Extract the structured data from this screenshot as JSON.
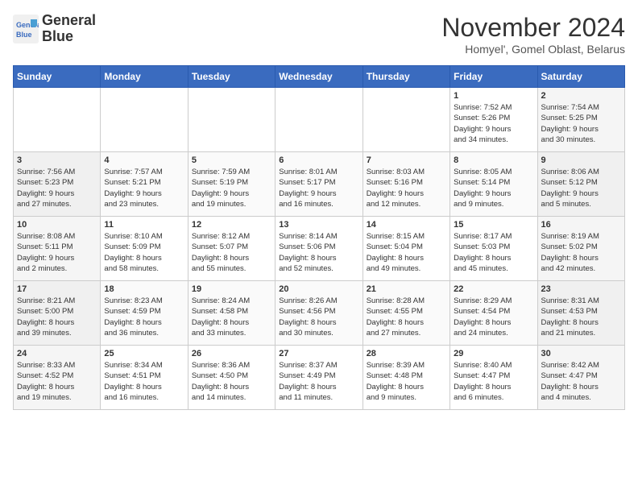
{
  "header": {
    "logo_line1": "General",
    "logo_line2": "Blue",
    "month_title": "November 2024",
    "subtitle": "Homyel', Gomel Oblast, Belarus"
  },
  "days_of_week": [
    "Sunday",
    "Monday",
    "Tuesday",
    "Wednesday",
    "Thursday",
    "Friday",
    "Saturday"
  ],
  "weeks": [
    [
      {
        "day": "",
        "info": ""
      },
      {
        "day": "",
        "info": ""
      },
      {
        "day": "",
        "info": ""
      },
      {
        "day": "",
        "info": ""
      },
      {
        "day": "",
        "info": ""
      },
      {
        "day": "1",
        "info": "Sunrise: 7:52 AM\nSunset: 5:26 PM\nDaylight: 9 hours\nand 34 minutes."
      },
      {
        "day": "2",
        "info": "Sunrise: 7:54 AM\nSunset: 5:25 PM\nDaylight: 9 hours\nand 30 minutes."
      }
    ],
    [
      {
        "day": "3",
        "info": "Sunrise: 7:56 AM\nSunset: 5:23 PM\nDaylight: 9 hours\nand 27 minutes."
      },
      {
        "day": "4",
        "info": "Sunrise: 7:57 AM\nSunset: 5:21 PM\nDaylight: 9 hours\nand 23 minutes."
      },
      {
        "day": "5",
        "info": "Sunrise: 7:59 AM\nSunset: 5:19 PM\nDaylight: 9 hours\nand 19 minutes."
      },
      {
        "day": "6",
        "info": "Sunrise: 8:01 AM\nSunset: 5:17 PM\nDaylight: 9 hours\nand 16 minutes."
      },
      {
        "day": "7",
        "info": "Sunrise: 8:03 AM\nSunset: 5:16 PM\nDaylight: 9 hours\nand 12 minutes."
      },
      {
        "day": "8",
        "info": "Sunrise: 8:05 AM\nSunset: 5:14 PM\nDaylight: 9 hours\nand 9 minutes."
      },
      {
        "day": "9",
        "info": "Sunrise: 8:06 AM\nSunset: 5:12 PM\nDaylight: 9 hours\nand 5 minutes."
      }
    ],
    [
      {
        "day": "10",
        "info": "Sunrise: 8:08 AM\nSunset: 5:11 PM\nDaylight: 9 hours\nand 2 minutes."
      },
      {
        "day": "11",
        "info": "Sunrise: 8:10 AM\nSunset: 5:09 PM\nDaylight: 8 hours\nand 58 minutes."
      },
      {
        "day": "12",
        "info": "Sunrise: 8:12 AM\nSunset: 5:07 PM\nDaylight: 8 hours\nand 55 minutes."
      },
      {
        "day": "13",
        "info": "Sunrise: 8:14 AM\nSunset: 5:06 PM\nDaylight: 8 hours\nand 52 minutes."
      },
      {
        "day": "14",
        "info": "Sunrise: 8:15 AM\nSunset: 5:04 PM\nDaylight: 8 hours\nand 49 minutes."
      },
      {
        "day": "15",
        "info": "Sunrise: 8:17 AM\nSunset: 5:03 PM\nDaylight: 8 hours\nand 45 minutes."
      },
      {
        "day": "16",
        "info": "Sunrise: 8:19 AM\nSunset: 5:02 PM\nDaylight: 8 hours\nand 42 minutes."
      }
    ],
    [
      {
        "day": "17",
        "info": "Sunrise: 8:21 AM\nSunset: 5:00 PM\nDaylight: 8 hours\nand 39 minutes."
      },
      {
        "day": "18",
        "info": "Sunrise: 8:23 AM\nSunset: 4:59 PM\nDaylight: 8 hours\nand 36 minutes."
      },
      {
        "day": "19",
        "info": "Sunrise: 8:24 AM\nSunset: 4:58 PM\nDaylight: 8 hours\nand 33 minutes."
      },
      {
        "day": "20",
        "info": "Sunrise: 8:26 AM\nSunset: 4:56 PM\nDaylight: 8 hours\nand 30 minutes."
      },
      {
        "day": "21",
        "info": "Sunrise: 8:28 AM\nSunset: 4:55 PM\nDaylight: 8 hours\nand 27 minutes."
      },
      {
        "day": "22",
        "info": "Sunrise: 8:29 AM\nSunset: 4:54 PM\nDaylight: 8 hours\nand 24 minutes."
      },
      {
        "day": "23",
        "info": "Sunrise: 8:31 AM\nSunset: 4:53 PM\nDaylight: 8 hours\nand 21 minutes."
      }
    ],
    [
      {
        "day": "24",
        "info": "Sunrise: 8:33 AM\nSunset: 4:52 PM\nDaylight: 8 hours\nand 19 minutes."
      },
      {
        "day": "25",
        "info": "Sunrise: 8:34 AM\nSunset: 4:51 PM\nDaylight: 8 hours\nand 16 minutes."
      },
      {
        "day": "26",
        "info": "Sunrise: 8:36 AM\nSunset: 4:50 PM\nDaylight: 8 hours\nand 14 minutes."
      },
      {
        "day": "27",
        "info": "Sunrise: 8:37 AM\nSunset: 4:49 PM\nDaylight: 8 hours\nand 11 minutes."
      },
      {
        "day": "28",
        "info": "Sunrise: 8:39 AM\nSunset: 4:48 PM\nDaylight: 8 hours\nand 9 minutes."
      },
      {
        "day": "29",
        "info": "Sunrise: 8:40 AM\nSunset: 4:47 PM\nDaylight: 8 hours\nand 6 minutes."
      },
      {
        "day": "30",
        "info": "Sunrise: 8:42 AM\nSunset: 4:47 PM\nDaylight: 8 hours\nand 4 minutes."
      }
    ]
  ]
}
